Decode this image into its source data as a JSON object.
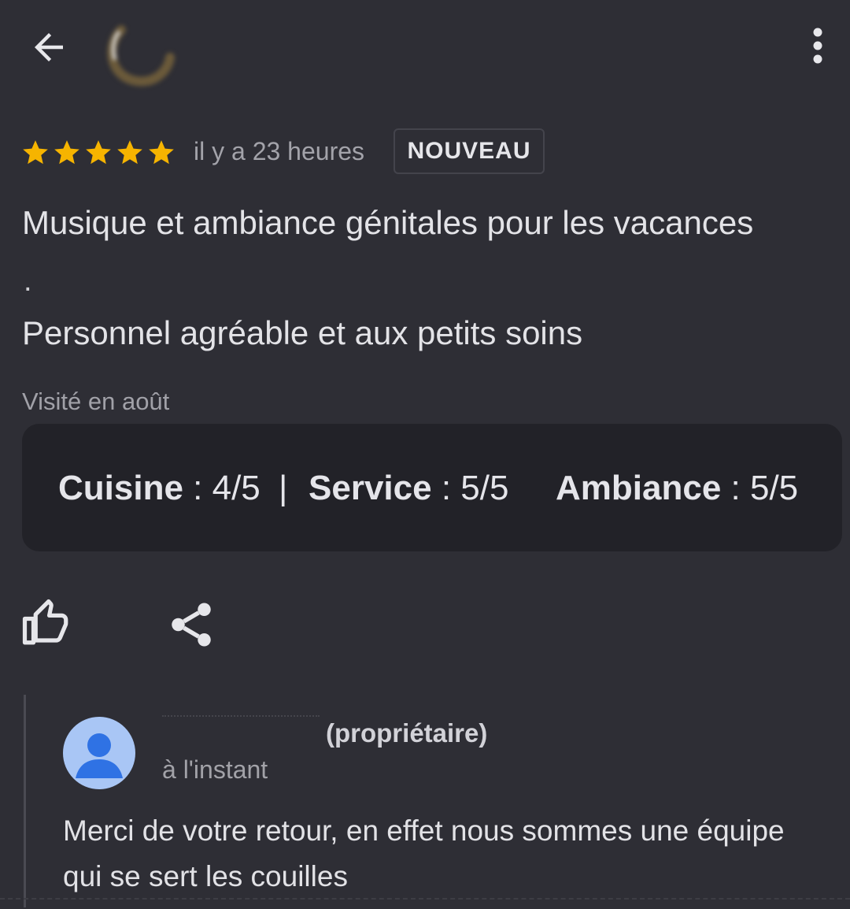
{
  "header": {
    "back_icon": "arrow-left-icon",
    "menu_icon": "more-vertical-icon"
  },
  "review": {
    "rating": 5,
    "rating_max": 5,
    "star_color": "#f6b400",
    "time_ago": "il y a 23 heures",
    "badge": "NOUVEAU",
    "text_line_1": "Musique et ambiance génitales pour les vacances",
    "text_line_2": ".",
    "text_line_3": "Personnel agréable et aux petits soins",
    "visited": "Visité en août"
  },
  "subratings": {
    "cuisine_label": "Cuisine",
    "cuisine_value": ": 4/5",
    "separator": "|",
    "service_label": "Service",
    "service_value": ": 5/5",
    "ambiance_label": "Ambiance",
    "ambiance_value": ": 5/5"
  },
  "actions": {
    "like_icon": "thumbs-up-icon",
    "share_icon": "share-icon"
  },
  "reply": {
    "owner_tag": "(propriétaire)",
    "time": "à l'instant",
    "text": "Merci de votre retour, en effet nous sommes une équipe qui se sert les couilles",
    "avatar_color": "#a9c6f5",
    "avatar_figure_color": "#2f72e4"
  }
}
